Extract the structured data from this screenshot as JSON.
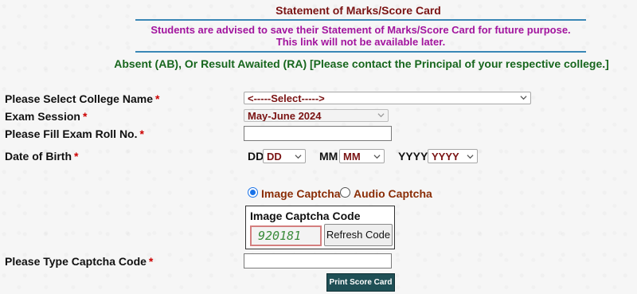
{
  "header": {
    "title": "Statement of Marks/Score Card",
    "advice_line1": "Students are advised to save their Statement of Marks/Score Card for future purpose.",
    "advice_line2": "This link will not be available later.",
    "absent_note": "Absent (AB), Or Result Awaited (RA) [Please contact the Principal of your respective college.]"
  },
  "form": {
    "college_label": "Please Select College Name",
    "college_value": "<-----Select----->",
    "session_label": "Exam Session",
    "session_value": "May-June 2024",
    "rollno_label": "Please Fill Exam Roll No.",
    "rollno_value": "",
    "dob_label": "Date of Birth",
    "dd_label": "DD",
    "dd_value": "DD",
    "mm_label": "MM",
    "mm_value": "MM",
    "yyyy_label": "YYYY",
    "yyyy_value": "YYYY",
    "required_mark": "*"
  },
  "captcha": {
    "option_image": "Image Captcha",
    "option_audio": "Audio Captcha",
    "box_title": "Image Captcha Code",
    "code": "920181",
    "refresh_label": "Refresh Code",
    "type_label": "Please Type Captcha Code",
    "type_value": ""
  },
  "actions": {
    "print_label": "Print Score Card"
  },
  "colors": {
    "title": "#7a1313",
    "advice": "#a2149e",
    "absent": "#17661d",
    "rule": "#3a87b6",
    "print_button": "#1f4f55"
  }
}
